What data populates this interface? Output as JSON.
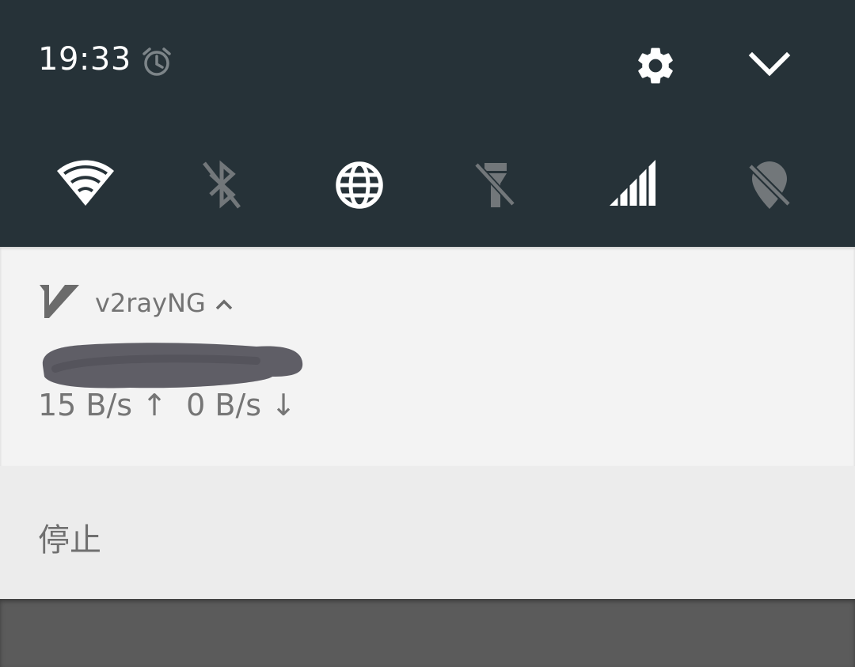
{
  "status_bar": {
    "time": "19:33",
    "alarm_icon": "alarm-clock-icon",
    "settings_icon": "gear-icon",
    "expand_icon": "chevron-down-icon"
  },
  "quick_settings": {
    "tiles": [
      {
        "name": "wifi",
        "icon": "wifi-icon",
        "state": "on"
      },
      {
        "name": "bluetooth",
        "icon": "bluetooth-off-icon",
        "state": "off"
      },
      {
        "name": "vpn",
        "icon": "globe-icon",
        "state": "on"
      },
      {
        "name": "flashlight",
        "icon": "flashlight-off-icon",
        "state": "off"
      },
      {
        "name": "mobile-data",
        "icon": "cellular-signal-icon",
        "state": "on"
      },
      {
        "name": "location",
        "icon": "location-off-icon",
        "state": "off"
      }
    ]
  },
  "notification": {
    "app_icon": "v2rayng-logo",
    "app_name": "v2rayNG",
    "title_redacted": true,
    "upload_speed": "15 B/s",
    "upload_arrow": "↑",
    "download_speed": "0 B/s",
    "download_arrow": "↓",
    "speed_text": "15 B/s ↑  0 B/s ↓"
  },
  "actions": {
    "stop_label": "停止"
  },
  "colors": {
    "shade_bg": "#263238",
    "notification_bg": "#f3f3f3",
    "action_bg": "#ececec",
    "scrim": "#5b5b5b",
    "icon_on": "#ffffff",
    "icon_off": "#72777a"
  }
}
